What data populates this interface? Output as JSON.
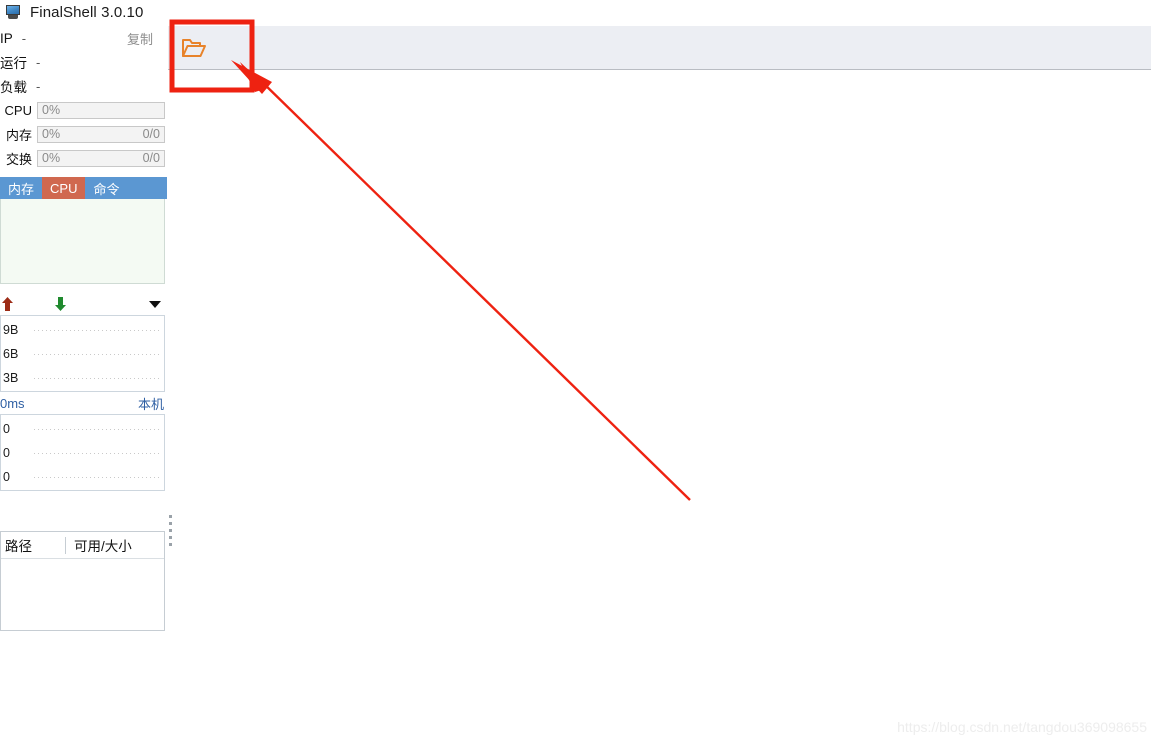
{
  "window": {
    "title": "FinalShell 3.0.10",
    "icon": "computer-monitor-icon"
  },
  "toolbar": {
    "open_folder_icon": "open-folder-icon",
    "open_folder_color": "#e8832a",
    "background": "#eceef3"
  },
  "info_panel": {
    "rows": [
      {
        "label": "IP",
        "value": "-",
        "action": "复制"
      },
      {
        "label": "运行",
        "value": "-",
        "action": ""
      },
      {
        "label": "负载",
        "value": "-",
        "action": ""
      }
    ],
    "meters": [
      {
        "label": "CPU",
        "percent": "0%",
        "detail": "",
        "value": 0
      },
      {
        "label": "内存",
        "percent": "0%",
        "detail": "0/0",
        "value": 0
      },
      {
        "label": "交换",
        "percent": "0%",
        "detail": "0/0",
        "value": 0
      }
    ],
    "tabs": [
      {
        "label": "内存",
        "active": false
      },
      {
        "label": "CPU",
        "active": true
      },
      {
        "label": "命令",
        "active": false
      }
    ],
    "tab_colors": {
      "inactive": "#5b97d2",
      "active": "#d0684f"
    },
    "network": {
      "upload_icon": "arrow-up-icon",
      "download_icon": "arrow-down-icon",
      "menu_icon": "chevron-down-icon",
      "y_labels": [
        "9B",
        "6B",
        "3B"
      ]
    },
    "ping": {
      "latency": "0ms",
      "host": "本机",
      "y_labels": [
        "0",
        "0",
        "0"
      ]
    },
    "disk": {
      "columns": [
        "路径",
        "可用/大小"
      ],
      "rows": []
    }
  },
  "annotation": {
    "highlight_color": "#ee2211",
    "shape": "rectangle-with-arrow",
    "target": "open-folder-icon"
  },
  "watermark": {
    "text": "https://blog.csdn.net/tangdou369098655"
  }
}
